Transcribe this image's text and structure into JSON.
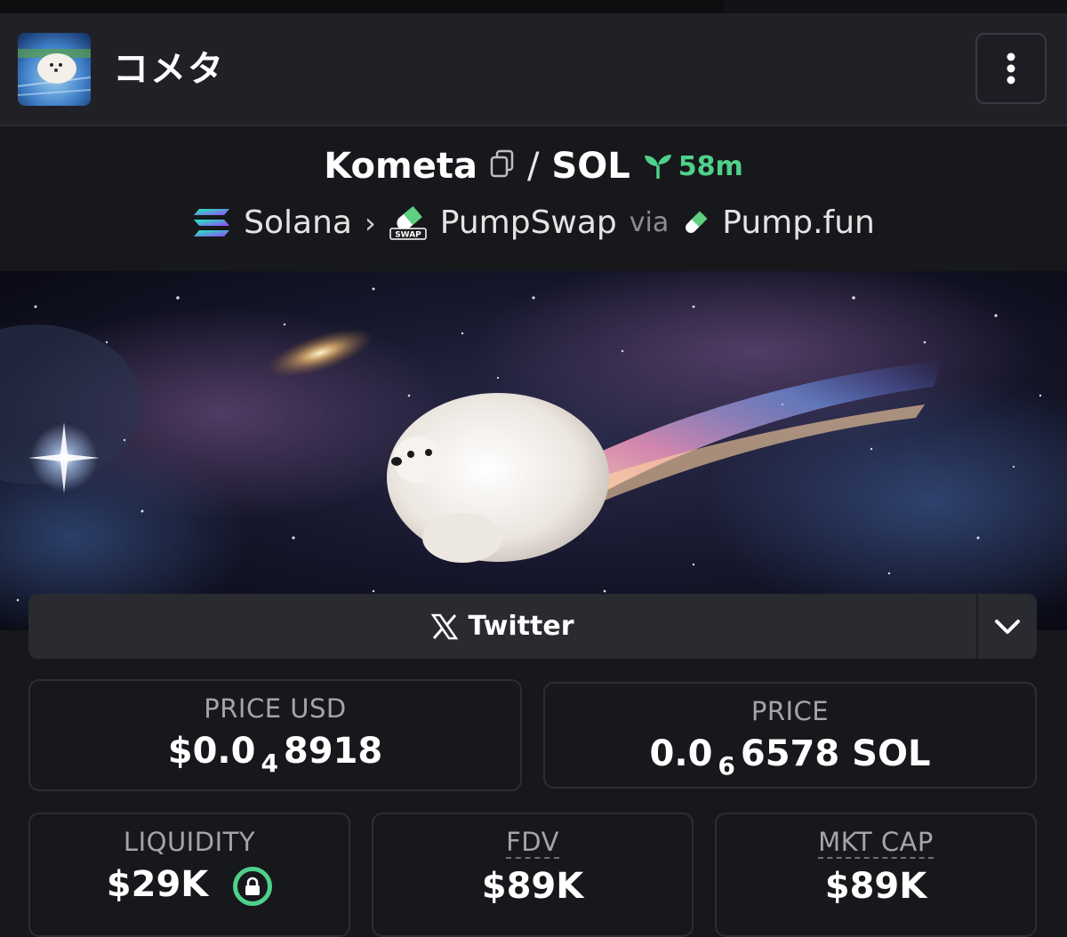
{
  "header": {
    "token_name_jp": "コメタ",
    "avatar_icon": "dog-avatar-icon",
    "menu_icon": "kebab-menu-icon"
  },
  "pair": {
    "base": "Kometa",
    "quote": "SOL",
    "slash": "/",
    "age": "58m",
    "age_color": "#4fd18b"
  },
  "chain": {
    "network": "Solana",
    "dex": "PumpSwap",
    "via_label": "via",
    "launchpad": "Pump.fun",
    "separator": "›"
  },
  "banner": {
    "image": "comet-dog-space-banner"
  },
  "social": {
    "twitter_label": "Twitter",
    "twitter_icon": "x-logo-icon",
    "expand_icon": "chevron-down-icon"
  },
  "stats": {
    "price_usd": {
      "label": "PRICE USD",
      "prefix": "$0.0",
      "sub": "4",
      "suffix": "8918"
    },
    "price_native": {
      "label": "PRICE",
      "prefix": "0.0",
      "sub": "6",
      "suffix": "6578 SOL"
    },
    "liquidity": {
      "label": "LIQUIDITY",
      "value": "$29K"
    },
    "fdv": {
      "label": "FDV",
      "value": "$89K"
    },
    "mkt_cap": {
      "label": "MKT CAP",
      "value": "$89K"
    }
  }
}
